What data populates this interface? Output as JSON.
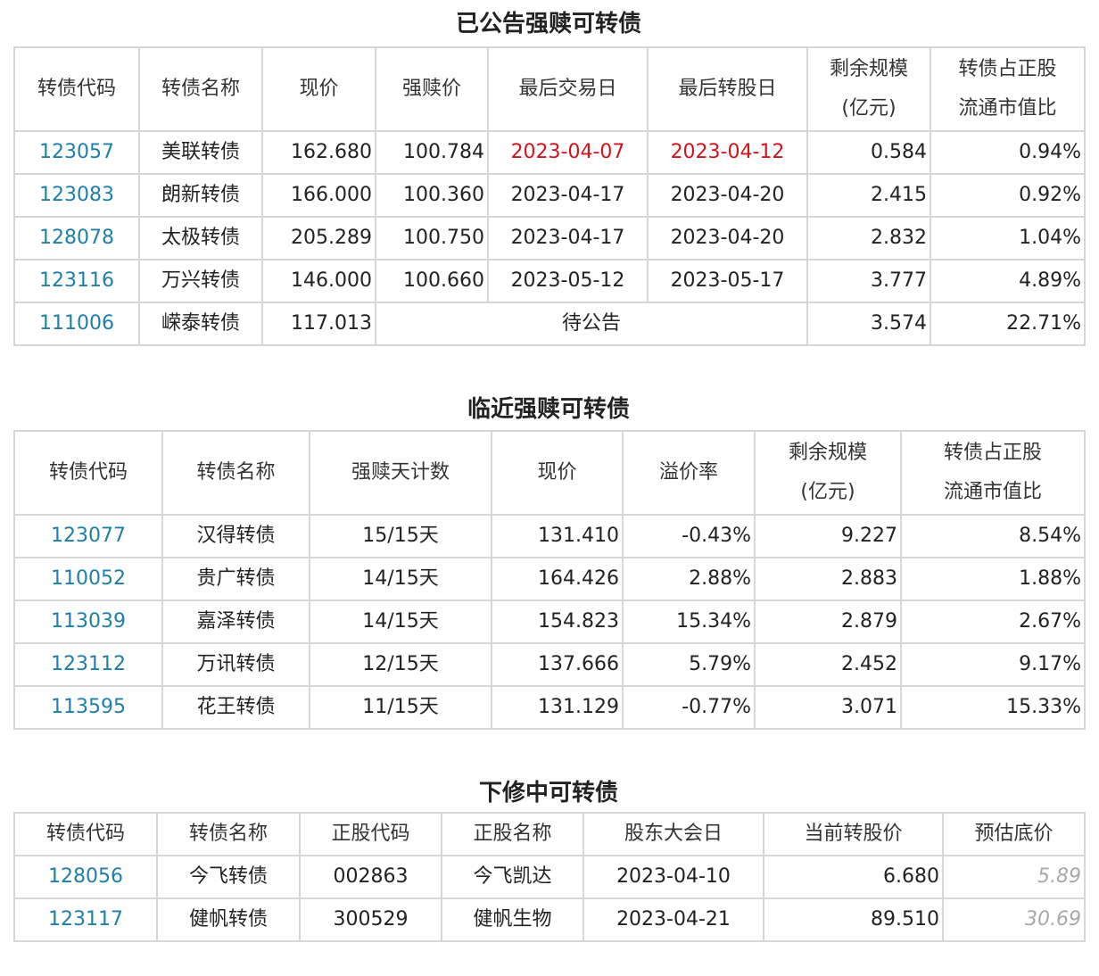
{
  "announced": {
    "title": "已公告强赎可转债",
    "headers": [
      "转债代码",
      "转债名称",
      "现价",
      "强赎价",
      "最后交易日",
      "最后转股日",
      "剩余规模",
      "(亿元)",
      "转债占正股",
      "流通市值比"
    ],
    "rows": [
      {
        "code": "123057",
        "name": "美联转债",
        "price": "162.680",
        "redeem": "100.784",
        "last_trade": "2023-04-07",
        "last_convert": "2023-04-12",
        "scale": "0.584",
        "ratio": "0.94%"
      },
      {
        "code": "123083",
        "name": "朗新转债",
        "price": "166.000",
        "redeem": "100.360",
        "last_trade": "2023-04-17",
        "last_convert": "2023-04-20",
        "scale": "2.415",
        "ratio": "0.92%"
      },
      {
        "code": "128078",
        "name": "太极转债",
        "price": "205.289",
        "redeem": "100.750",
        "last_trade": "2023-04-17",
        "last_convert": "2023-04-20",
        "scale": "2.832",
        "ratio": "1.04%"
      },
      {
        "code": "123116",
        "name": "万兴转债",
        "price": "146.000",
        "redeem": "100.660",
        "last_trade": "2023-05-12",
        "last_convert": "2023-05-17",
        "scale": "3.777",
        "ratio": "4.89%"
      },
      {
        "code": "111006",
        "name": "嵘泰转债",
        "price": "117.013",
        "pending": "待公告",
        "scale": "3.574",
        "ratio": "22.71%"
      }
    ]
  },
  "upcoming": {
    "title": "临近强赎可转债",
    "headers": [
      "转债代码",
      "转债名称",
      "强赎天计数",
      "现价",
      "溢价率",
      "剩余规模",
      "(亿元)",
      "转债占正股",
      "流通市值比"
    ],
    "rows": [
      {
        "code": "123077",
        "name": "汉得转债",
        "days": "15/15天",
        "price": "131.410",
        "premium": "-0.43%",
        "scale": "9.227",
        "ratio": "8.54%"
      },
      {
        "code": "110052",
        "name": "贵广转债",
        "days": "14/15天",
        "price": "164.426",
        "premium": "2.88%",
        "scale": "2.883",
        "ratio": "1.88%"
      },
      {
        "code": "113039",
        "name": "嘉泽转债",
        "days": "14/15天",
        "price": "154.823",
        "premium": "15.34%",
        "scale": "2.879",
        "ratio": "2.67%"
      },
      {
        "code": "123112",
        "name": "万讯转债",
        "days": "12/15天",
        "price": "137.666",
        "premium": "5.79%",
        "scale": "2.452",
        "ratio": "9.17%"
      },
      {
        "code": "113595",
        "name": "花王转债",
        "days": "11/15天",
        "price": "131.129",
        "premium": "-0.77%",
        "scale": "3.071",
        "ratio": "15.33%"
      }
    ]
  },
  "revision": {
    "title": "下修中可转债",
    "headers": [
      "转债代码",
      "转债名称",
      "正股代码",
      "正股名称",
      "股东大会日",
      "当前转股价",
      "预估底价"
    ],
    "rows": [
      {
        "code": "128056",
        "name": "今飞转债",
        "stock_code": "002863",
        "stock_name": "今飞凯达",
        "meeting": "2023-04-10",
        "conv_price": "6.680",
        "floor": "5.89"
      },
      {
        "code": "123117",
        "name": "健帆转债",
        "stock_code": "300529",
        "stock_name": "健帆生物",
        "meeting": "2023-04-21",
        "conv_price": "89.510",
        "floor": "30.69"
      }
    ]
  },
  "colors": {
    "link": "#1f7fa8",
    "highlight": "#d0141c",
    "estimate": "#a8a8a8",
    "border": "#d7d7d7"
  }
}
